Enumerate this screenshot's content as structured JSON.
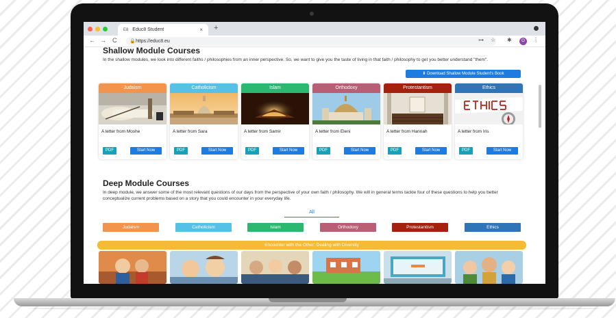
{
  "browser": {
    "tab_title": "Educ8 Student",
    "tab_favicon": "E8",
    "tab_close": "×",
    "new_tab": "+",
    "url": "https://educ8.eu",
    "back": "←",
    "forward": "→",
    "reload": "C",
    "key_icon": "⊶",
    "star_icon": "☆",
    "puzzle_icon": "✱",
    "profile_initial": "O",
    "menu_icon": "⋮"
  },
  "shallow": {
    "title": "Shallow Module Courses",
    "description": "In the shallow modules, we look into different faiths / philosophies from an inner perspective. So, we want to give you the taste of living in that faith / philosophy to get you better understand \"them\".",
    "download_label": "Download Shallow Module Student's Book",
    "download_icon": "⬇",
    "courses": [
      {
        "faith": "Judaism",
        "letter": "A letter from Moshe",
        "pdf": "PDF",
        "start": "Start Now",
        "color": "#f0944e"
      },
      {
        "faith": "Catholicism",
        "letter": "A letter from Sara",
        "pdf": "PDF",
        "start": "Start Now",
        "color": "#56c0e6"
      },
      {
        "faith": "Islam",
        "letter": "A letter from Samir",
        "pdf": "PDF",
        "start": "Start Now",
        "color": "#2db871"
      },
      {
        "faith": "Orthodoxy",
        "letter": "A letter from Eleni",
        "pdf": "PDF",
        "start": "Start Now",
        "color": "#b95f75"
      },
      {
        "faith": "Protestantism",
        "letter": "A letter from Hannah",
        "pdf": "PDF",
        "start": "Start Now",
        "color": "#a3210d"
      },
      {
        "faith": "Ethics",
        "letter": "A letter from Iris",
        "pdf": "PDF",
        "start": "Start Now",
        "color": "#2e74b7"
      }
    ]
  },
  "deep": {
    "title": "Deep Module Courses",
    "description": "In deep module, we answer some of the most relevant questions of our days from the perspective of your own faith / philosophy. We will in general terms tackle four of these questions to help you better conceptualize current problems based on a story that you could encounter in your everyday life.",
    "filter_all": "All",
    "filters": [
      {
        "label": "Judaism",
        "color": "#f0944e"
      },
      {
        "label": "Catholicism",
        "color": "#56c0e6"
      },
      {
        "label": "Islam",
        "color": "#2db871"
      },
      {
        "label": "Orthodoxy",
        "color": "#b95f75"
      },
      {
        "label": "Protestantism",
        "color": "#a3210d"
      },
      {
        "label": "Ethics",
        "color": "#2e74b7"
      }
    ],
    "banner": "Encounter with the Other: Dealing with Diversity"
  }
}
